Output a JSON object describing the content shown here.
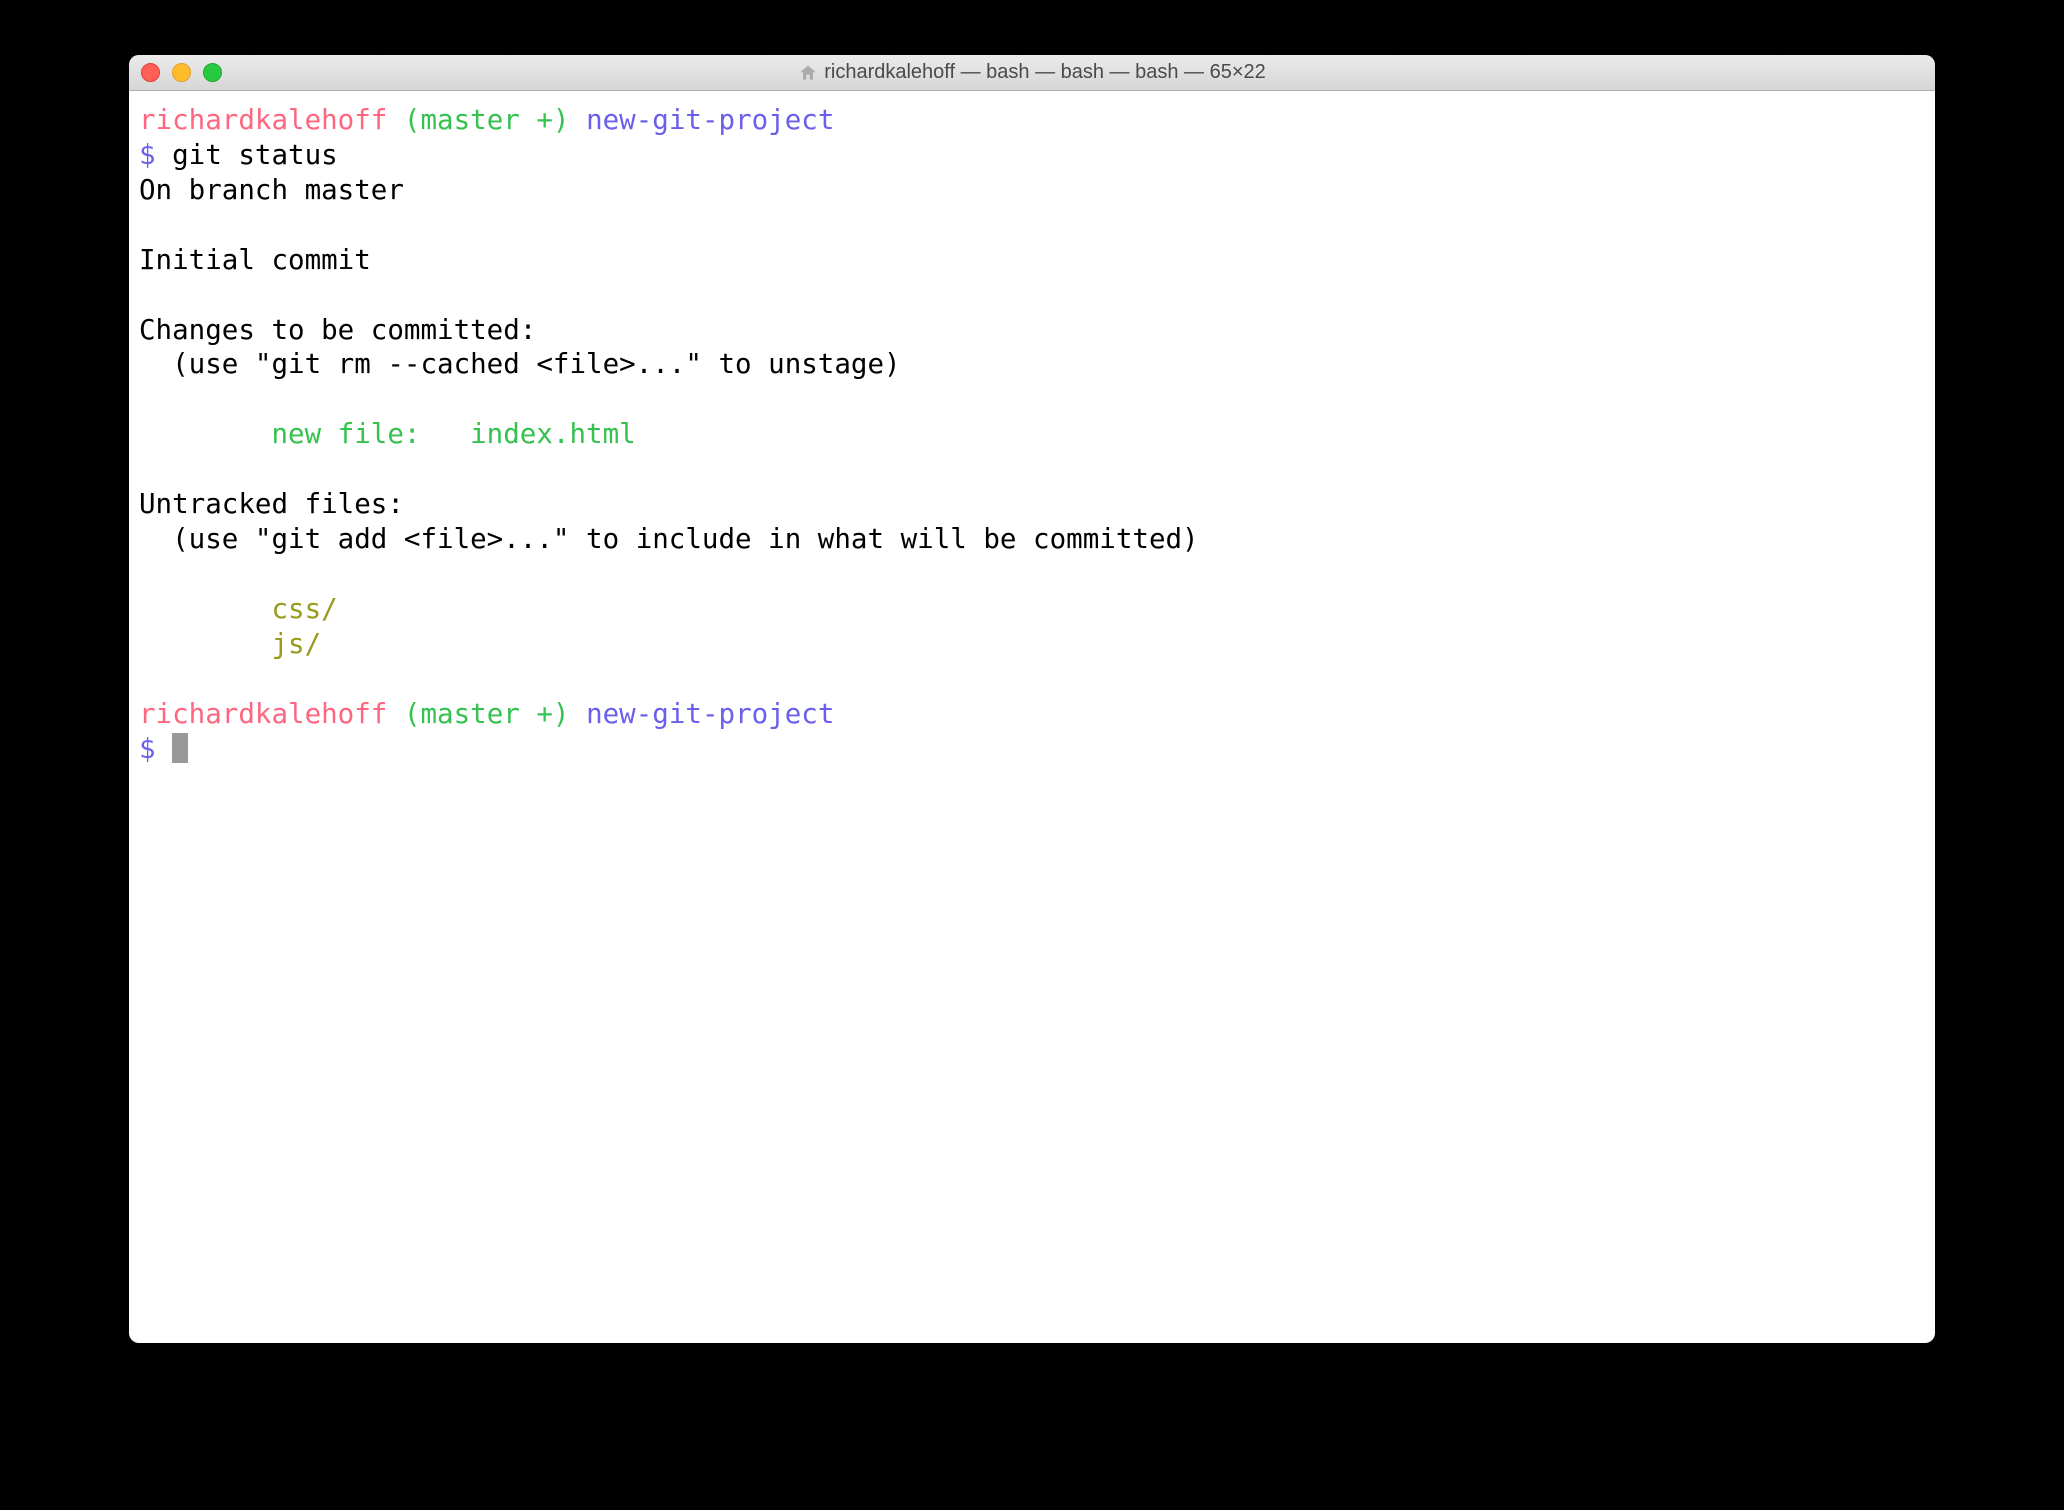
{
  "window": {
    "title": "richardkalehoff — bash — bash — bash — 65×22"
  },
  "prompt": {
    "user": "richardkalehoff",
    "branch": "(master +)",
    "dir": "new-git-project",
    "symbol": "$"
  },
  "session": {
    "command1": "git status",
    "out_branch": "On branch master",
    "out_initial": "Initial commit",
    "out_changes_header": "Changes to be committed:",
    "out_changes_hint": "  (use \"git rm --cached <file>...\" to unstage)",
    "out_staged_file": "        new file:   index.html",
    "out_untracked_header": "Untracked files:",
    "out_untracked_hint": "  (use \"git add <file>...\" to include in what will be committed)",
    "out_untracked_1": "        css/",
    "out_untracked_2": "        js/"
  }
}
